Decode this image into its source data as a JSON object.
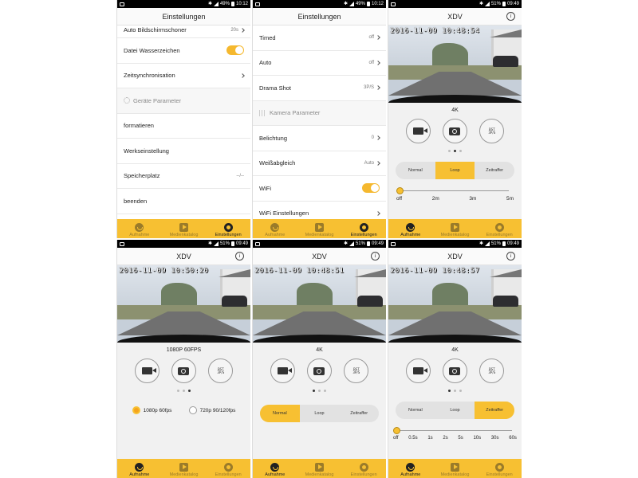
{
  "status_bars": [
    {
      "battery": "49%",
      "time": "10:12"
    },
    {
      "battery": "49%",
      "time": "10:12"
    },
    {
      "battery": "51%",
      "time": "09:49"
    },
    {
      "battery": "51%",
      "time": "09:49"
    },
    {
      "battery": "51%",
      "time": "09:49"
    },
    {
      "battery": "51%",
      "time": "09:49"
    }
  ],
  "tabs": {
    "record": "Aufnahme",
    "media": "Medienkatalog",
    "settings": "Einstellungen"
  },
  "settings1": {
    "title": "Einstellungen",
    "rows": {
      "screensaver": {
        "label": "Auto Bildschirmschoner",
        "value": "20s"
      },
      "watermark": {
        "label": "Datei Wasserzeichen"
      },
      "timesync": {
        "label": "Zeitsynchronisation"
      },
      "device_section": {
        "label": "Geräte Parameter"
      },
      "format": {
        "label": "formatieren"
      },
      "factory": {
        "label": "Werkseinstellung"
      },
      "storage": {
        "label": "Speicherplatz",
        "value": "--/--"
      },
      "quit": {
        "label": "beenden"
      }
    }
  },
  "settings2": {
    "title": "Einstellungen",
    "rows": {
      "timed": {
        "label": "Timed",
        "value": "off"
      },
      "auto": {
        "label": "Auto",
        "value": "off"
      },
      "drama": {
        "label": "Drama Shot",
        "value": "3P/S"
      },
      "camera_section": {
        "label": "Kamera Parameter"
      },
      "exposure": {
        "label": "Belichtung",
        "value": "0"
      },
      "wb": {
        "label": "Weißabgleich",
        "value": "Auto"
      },
      "wifi": {
        "label": "WiFi"
      },
      "wifi_settings": {
        "label": "WiFi Einstellungen"
      }
    }
  },
  "camera_title": "XDV",
  "camera_screens": [
    {
      "timestamp": "2016-11-09 10:48:54",
      "resolution": "4K",
      "page": 2
    },
    {
      "timestamp": "2016-11-09 10:50:20",
      "resolution": "1080P 60FPS",
      "page": 3
    },
    {
      "timestamp": "2016-11-09 10:48:51",
      "resolution": "4K",
      "page": 1
    },
    {
      "timestamp": "2016-11-09 10:48:57",
      "resolution": "4K",
      "page": 1
    }
  ],
  "modes": {
    "normal": "Normal",
    "loop": "Loop",
    "timelapse": "Zeitraffer"
  },
  "loop_slider": {
    "value": "off",
    "labels": [
      "off",
      "2m",
      "3m",
      "5m"
    ]
  },
  "timelapse_slider": {
    "value": "off",
    "labels": [
      "off",
      "0.5s",
      "1s",
      "2s",
      "5s",
      "10s",
      "30s",
      "60s"
    ]
  },
  "fps_options": {
    "opt1": "1080p 60fps",
    "opt2": "720p 90/120fps",
    "selected": "1080p 60fps"
  },
  "burst_icon_text": "BST 3P/S",
  "colors": {
    "accent": "#f7c032",
    "toggle_on": "#f5b82e"
  }
}
